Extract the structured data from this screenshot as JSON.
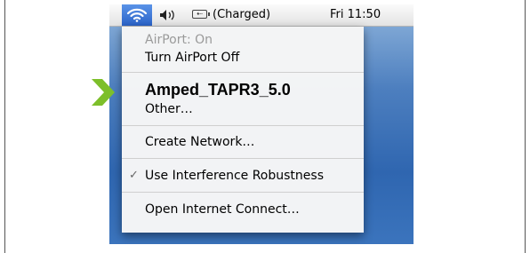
{
  "menubar": {
    "battery_label": "(Charged)",
    "battery_glyph": "⇠",
    "clock": "Fri 11:50"
  },
  "menu": {
    "status": "AirPort: On",
    "toggle": "Turn AirPort Off",
    "network": "Amped_TAPR3_5.0",
    "other": "Other…",
    "create": "Create Network…",
    "check_mark": "✓",
    "interference": "Use Interference Robustness",
    "internet_connect": "Open Internet Connect…"
  },
  "colors": {
    "arrow": "#7dbf2a",
    "airport_highlight": "#2a63c8"
  },
  "icons": {
    "airport": "wifi-icon",
    "volume": "volume-icon",
    "battery": "battery-icon",
    "pointer": "green-chevron-arrow"
  }
}
